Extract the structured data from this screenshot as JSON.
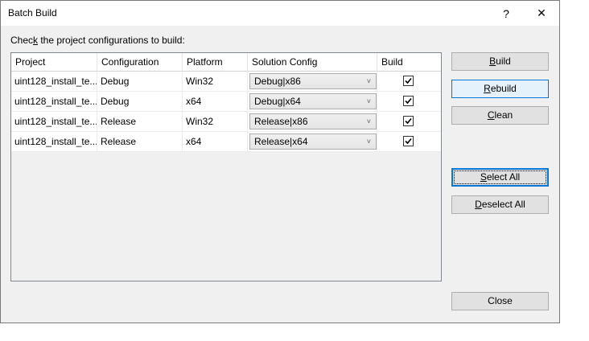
{
  "window": {
    "title": "Batch Build",
    "help_glyph": "?",
    "close_glyph": "✕"
  },
  "instruction": {
    "before": "Chec",
    "mnemonic": "k",
    "after": " the project configurations to build:"
  },
  "grid": {
    "headers": [
      "Project",
      "Configuration",
      "Platform",
      "Solution Config",
      "Build"
    ],
    "rows": [
      {
        "project": "uint128_install_te...",
        "configuration": "Debug",
        "platform": "Win32",
        "solution_config": "Debug|x86",
        "build": true
      },
      {
        "project": "uint128_install_te...",
        "configuration": "Debug",
        "platform": "x64",
        "solution_config": "Debug|x64",
        "build": true
      },
      {
        "project": "uint128_install_te...",
        "configuration": "Release",
        "platform": "Win32",
        "solution_config": "Release|x86",
        "build": true
      },
      {
        "project": "uint128_install_te...",
        "configuration": "Release",
        "platform": "x64",
        "solution_config": "Release|x64",
        "build": true
      }
    ]
  },
  "buttons": {
    "build": {
      "mnemonic": "B",
      "rest": "uild"
    },
    "rebuild": {
      "mnemonic": "R",
      "rest": "ebuild"
    },
    "clean": {
      "mnemonic": "C",
      "rest": "lean"
    },
    "select_all": {
      "mnemonic": "S",
      "rest": "elect All"
    },
    "deselect_all": {
      "mnemonic": "D",
      "rest": "eselect All"
    },
    "close": {
      "label": "Close"
    }
  },
  "colors": {
    "accent": "#0078d7",
    "dialog_bg": "#f0f0f0"
  }
}
